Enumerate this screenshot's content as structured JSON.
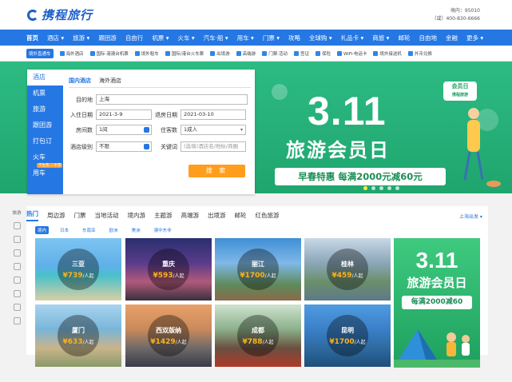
{
  "header": {
    "logo_text": "携程旅行",
    "hotline_label": "境内：95010",
    "hotline_alt": "（或）400-830-6666"
  },
  "nav": {
    "items": [
      "首页",
      "酒店 ▾",
      "旅游 ▾",
      "跟团游",
      "自由行",
      "机票 ▾",
      "火车 ▾",
      "汽车·船 ▾",
      "用车 ▾",
      "门票 ▾",
      "攻略",
      "全球购 ▾",
      "礼品卡 ▾",
      "商旅 ▾",
      "邮轮",
      "自由地",
      "金融",
      "更多 ▾"
    ]
  },
  "subnav": {
    "badge": "境外直通车",
    "items": [
      "海外酒店",
      "国际·港澳台机票",
      "境外租车",
      "国际/港台火车票",
      "出境游",
      "高端游",
      "门票·活动",
      "签证",
      "保险",
      "WiFi·电话卡",
      "境外接送机",
      "外币兑换"
    ]
  },
  "banner": {
    "badge_line1": "会员日",
    "badge_line2": "携程旅游",
    "big_text": "3.11",
    "title": "旅游会员日",
    "promo": "早春特惠 每满2000元减60元"
  },
  "search": {
    "tabs": [
      "酒店",
      "机票",
      "旅游",
      "跟团游",
      "打包订",
      "火车",
      "用车"
    ],
    "train_badge": "学生票·二手票",
    "form_tabs": [
      "国内酒店",
      "海外酒店"
    ],
    "destination_label": "目的地",
    "destination_value": "上海",
    "checkin_label": "入住日期",
    "checkin_value": "2021-3-9",
    "checkout_label": "退房日期",
    "checkout_value": "2021-03-10",
    "rooms_label": "房间数",
    "rooms_value": "1间",
    "guests_label": "住客数",
    "guests_value": "1成人",
    "level_label": "酒店级别",
    "level_value": "不限",
    "keyword_label": "关键词",
    "keyword_placeholder": "(选填)酒店名/地标/商圈",
    "search_button": "搜 索"
  },
  "content": {
    "side_label": "旅游",
    "tabs": [
      "热门",
      "周边游",
      "门票",
      "当地活动",
      "境内游",
      "主题游",
      "高端游",
      "出境游",
      "邮轮",
      "红色旅游"
    ],
    "city_pick": "上海出发 ▾",
    "region_tabs": [
      "境内",
      "日本",
      "东南亚",
      "欧洲",
      "美洲",
      "澳中东非"
    ],
    "unit": "/人起",
    "currency": "¥",
    "destinations": [
      {
        "name": "三亚",
        "price": "739"
      },
      {
        "name": "重庆",
        "price": "593"
      },
      {
        "name": "丽江",
        "price": "1700"
      },
      {
        "name": "桂林",
        "price": "459"
      },
      {
        "name": "厦门",
        "price": "633"
      },
      {
        "name": "西双版纳",
        "price": "1429"
      },
      {
        "name": "成都",
        "price": "788"
      },
      {
        "name": "昆明",
        "price": "1700"
      }
    ],
    "ad": {
      "big_text": "3.11",
      "title": "旅游会员日",
      "promo": "每满2000减60"
    }
  },
  "colors": {
    "brand_blue": "#2577e3",
    "accent_orange": "#ff9d1c",
    "banner_green": "#2dbb83"
  }
}
